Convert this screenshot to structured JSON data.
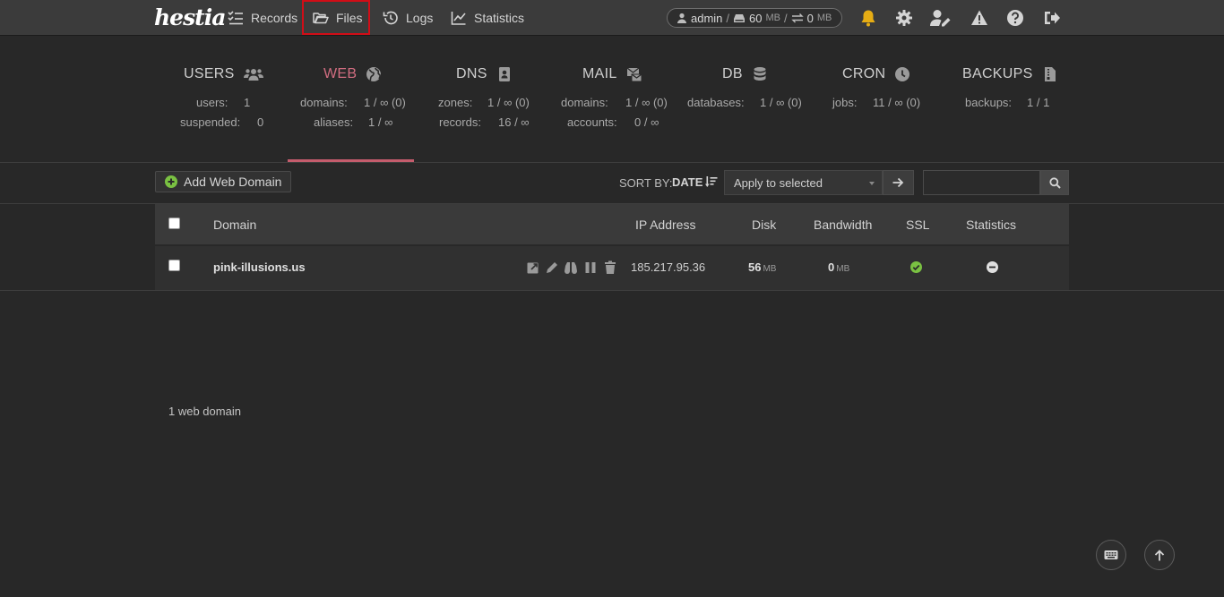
{
  "topbar": {
    "logo": "hestia",
    "nav": [
      {
        "label": "Records",
        "icon": "list-check-icon"
      },
      {
        "label": "Files",
        "icon": "folder-open-icon"
      },
      {
        "label": "Logs",
        "icon": "history-icon"
      },
      {
        "label": "Statistics",
        "icon": "chart-line-icon"
      }
    ],
    "user": {
      "name": "admin",
      "disk_value": "60",
      "disk_unit": "MB",
      "bw_value": "0",
      "bw_unit": "MB"
    },
    "icons": [
      "bell-icon",
      "gear-icon",
      "user-edit-icon",
      "warning-icon",
      "help-icon",
      "logout-icon"
    ],
    "colors": {
      "bell": "#e6ad14",
      "files_highlight": "#d10d17"
    }
  },
  "stats": {
    "users": {
      "title": "USERS",
      "r1_label": "users:",
      "r1_value": "1",
      "r2_label": "suspended:",
      "r2_value": "0"
    },
    "web": {
      "title": "WEB",
      "r1_label": "domains:",
      "r1_value": "1 / ∞ (0)",
      "r2_label": "aliases:",
      "r2_value": "1 / ∞"
    },
    "dns": {
      "title": "DNS",
      "r1_label": "zones:",
      "r1_value": "1 / ∞ (0)",
      "r2_label": "records:",
      "r2_value": "16 / ∞"
    },
    "mail": {
      "title": "MAIL",
      "r1_label": "domains:",
      "r1_value": "1 / ∞ (0)",
      "r2_label": "accounts:",
      "r2_value": "0 / ∞"
    },
    "db": {
      "title": "DB",
      "r1_label": "databases:",
      "r1_value": "1 / ∞ (0)"
    },
    "cron": {
      "title": "CRON",
      "r1_label": "jobs:",
      "r1_value": "11 / ∞ (0)"
    },
    "backups": {
      "title": "BACKUPS",
      "r1_label": "backups:",
      "r1_value": "1 / 1"
    },
    "active_color": "#d16d80"
  },
  "toolbar": {
    "add_label": "Add Web Domain",
    "sort_label": "SORT BY:",
    "sort_value": "DATE",
    "bulk_selected": "Apply to selected",
    "search_value": ""
  },
  "table": {
    "headers": {
      "domain": "Domain",
      "ip": "IP Address",
      "disk": "Disk",
      "bandwidth": "Bandwidth",
      "ssl": "SSL",
      "statistics": "Statistics"
    },
    "rows": [
      {
        "domain": "pink-illusions.us",
        "ip": "185.217.95.36",
        "disk": "56",
        "disk_unit": "MB",
        "bandwidth": "0",
        "bandwidth_unit": "MB",
        "ssl": "enabled",
        "statistics": "disabled"
      }
    ],
    "colors": {
      "ssl_enabled": "#7ac142"
    }
  },
  "footer": {
    "count": "1 web domain"
  }
}
